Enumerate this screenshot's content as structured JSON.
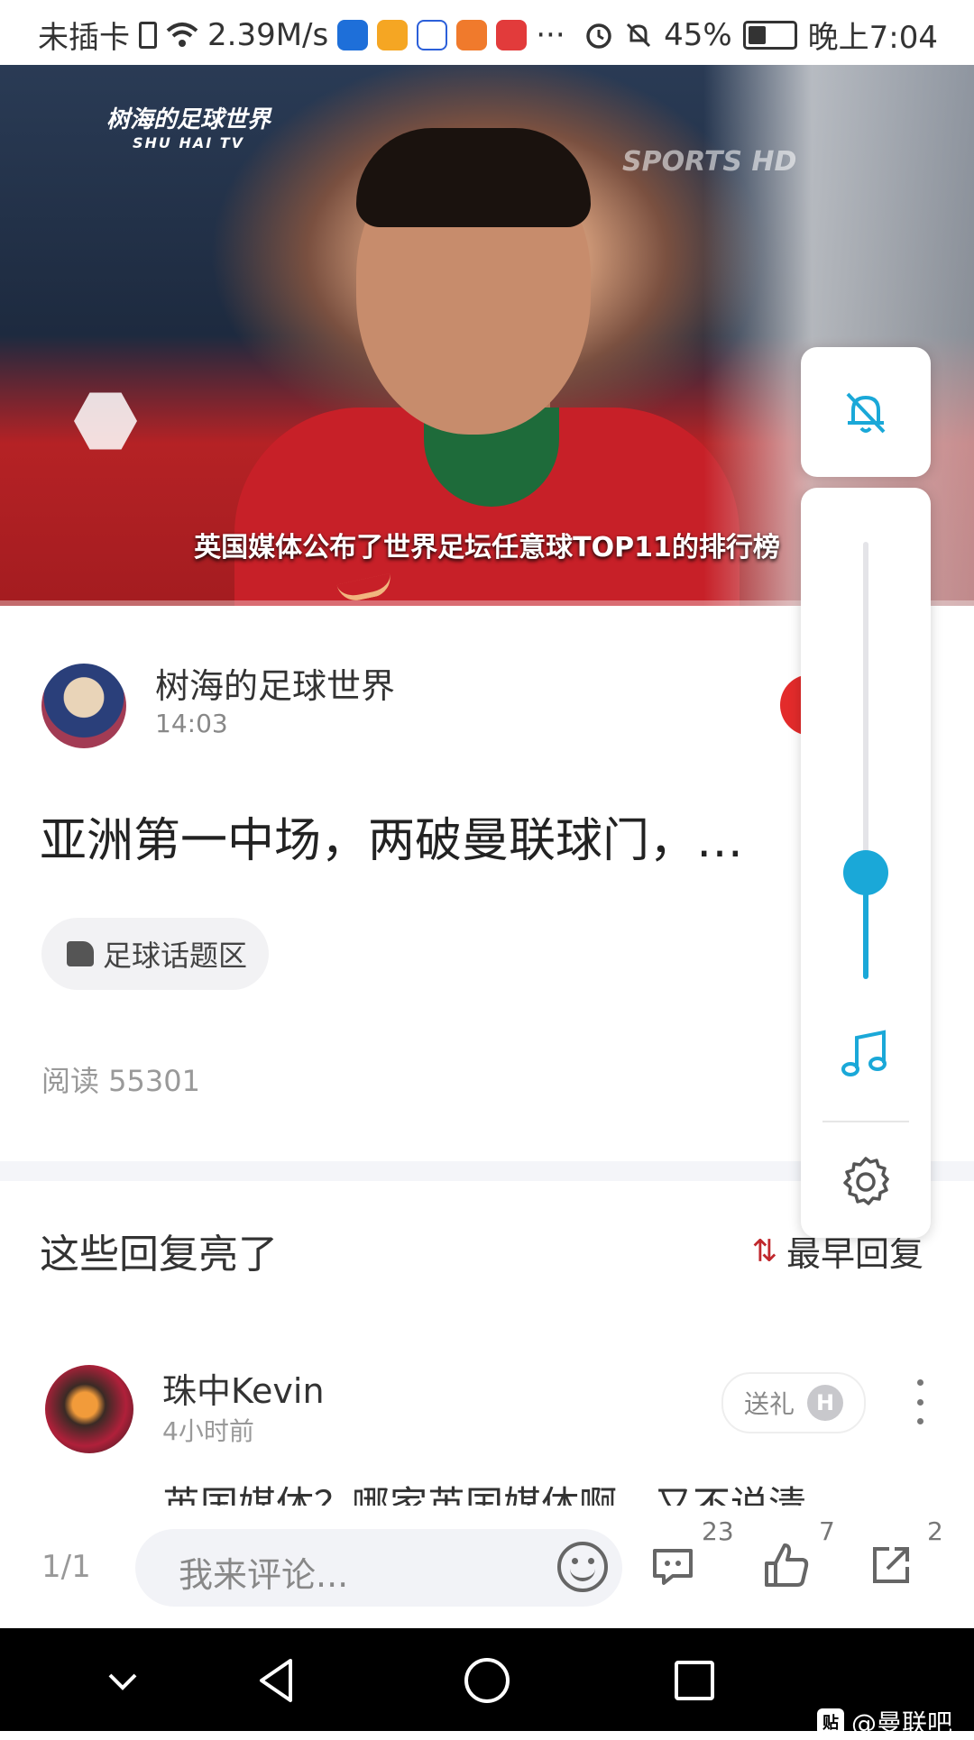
{
  "status_bar": {
    "carrier": "未插卡",
    "net_speed": "2.39M/s",
    "more": "···",
    "battery": "45%",
    "battery_level": 0.45,
    "time": "晚上7:04"
  },
  "video": {
    "channel_name": "树海的足球世界",
    "channel_sub": "SHU HAI TV",
    "watermark": "SPORTS HD",
    "caption": "英国媒体公布了世界足坛任意球TOP11的排行榜"
  },
  "post": {
    "author": "树海的足球世界",
    "time": "14:03",
    "title": "亚洲第一中场，两破曼联球门，…",
    "topic": "足球话题区",
    "read_label": "阅读 55301"
  },
  "replies": {
    "heading": "这些回复亮了",
    "sort_label": "最早回复",
    "items": [
      {
        "user": "珠中Kevin",
        "time": "4小时前",
        "gift_label": "送礼",
        "gift_badge": "H",
        "text": "英国媒体？哪家英国媒体啊，又不说清"
      }
    ]
  },
  "action_bar": {
    "page": "1/1",
    "comment_placeholder": "我来评论...",
    "comment_count": "23",
    "like_count": "7",
    "share_count": "2"
  },
  "volume_panel": {
    "level": 0.12,
    "accent": "#1aa8d8"
  },
  "navbar": {
    "watermark": "@曼联吧",
    "watermark_logo": "贴"
  },
  "colors": {
    "follow_red": "#e32b2b",
    "sort_icon": "#c0282d"
  }
}
